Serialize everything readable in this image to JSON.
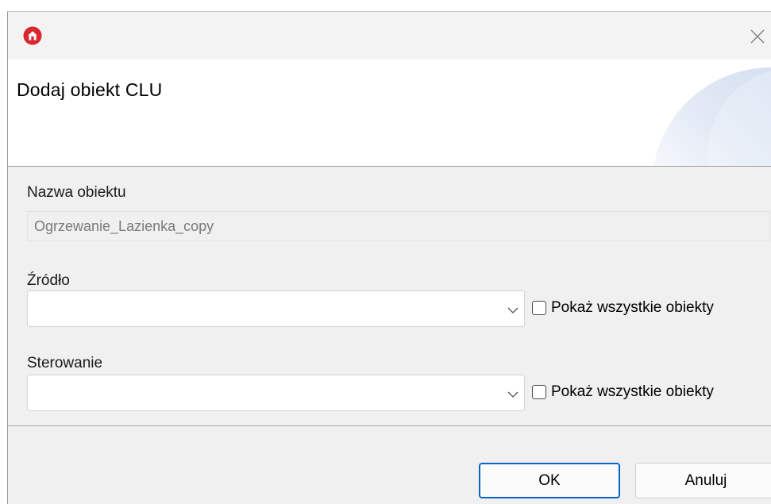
{
  "window": {
    "title": "Dodaj obiekt CLU",
    "app_icon": "home-icon",
    "close_icon": "close-icon",
    "close_glyph": "✕"
  },
  "form": {
    "name_label": "Nazwa obiektu",
    "name_value": "Ogrzewanie_Lazienka_copy",
    "source_label": "Źródło",
    "source_value": "",
    "source_show_all_label": "Pokaż wszystkie obiekty",
    "source_show_all_checked": false,
    "control_label": "Sterowanie",
    "control_value": "",
    "control_show_all_label": "Pokaż wszystkie obiekty",
    "control_show_all_checked": false
  },
  "buttons": {
    "ok_label": "OK",
    "cancel_label": "Anuluj"
  },
  "colors": {
    "app_icon": "#d9262f",
    "ok_border": "#0a64c8",
    "header_deco": "#e8eef8"
  }
}
